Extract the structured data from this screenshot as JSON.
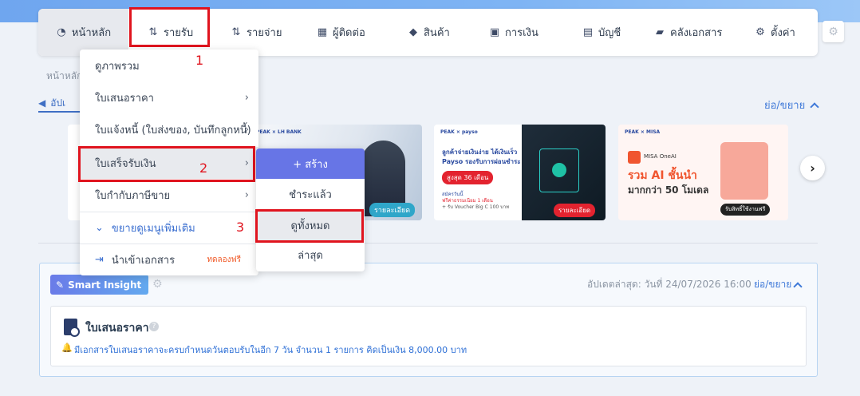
{
  "nav": {
    "items": [
      {
        "label": "หน้าหลัก",
        "icon": "dashboard-icon"
      },
      {
        "label": "รายรับ",
        "icon": "income-icon"
      },
      {
        "label": "รายจ่าย",
        "icon": "expense-icon"
      },
      {
        "label": "ผู้ติดต่อ",
        "icon": "contacts-icon"
      },
      {
        "label": "สินค้า",
        "icon": "box-icon"
      },
      {
        "label": "การเงิน",
        "icon": "money-icon"
      },
      {
        "label": "บัญชี",
        "icon": "ledger-icon"
      },
      {
        "label": "คลังเอกสาร",
        "icon": "folder-icon"
      },
      {
        "label": "ตั้งค่า",
        "icon": "gear-icon"
      }
    ]
  },
  "breadcrumb": "หน้าหลัก",
  "announcement_tab": "อัปเ",
  "collapse_label": "ย่อ/ขยาย",
  "dropdown": {
    "items": [
      {
        "label": "ดูภาพรวม"
      },
      {
        "label": "ใบเสนอราคา"
      },
      {
        "label": "ใบแจ้งหนี้ (ใบส่งของ, บันทึกลูกหนี้)"
      },
      {
        "label": "ใบเสร็จรับเงิน"
      },
      {
        "label": "ใบกำกับภาษีขาย"
      }
    ],
    "more_label": "ขยายดูเมนูเพิ่มเติม",
    "import_label": "นำเข้าเอกสาร",
    "import_badge": "ทดลองฟรี"
  },
  "submenu": {
    "create_label": "+ สร้าง",
    "items": [
      "ชำระแล้ว",
      "ดูทั้งหมด",
      "ล่าสุด"
    ]
  },
  "annotations": [
    "1",
    "2",
    "3"
  ],
  "banners": {
    "lh": {
      "logo": "PEAK × LH BANK",
      "button": "รายละเอียด"
    },
    "payso": {
      "logo": "PEAK × payso",
      "title_line1": "ลูกค้าจ่ายเงินง่าย ได้เงินเร็ว",
      "title_line2": "Payso รองรับการผ่อนชำระ",
      "pill": "สูงสุด 36 เดือน",
      "note_line1": "สมัครวันนี้",
      "note_line2": "ฟรีค่าธรรมเนียม 1 เดือน",
      "note_line3": "+ รับ Voucher Big C 100 บาท",
      "button": "รายละเอียด"
    },
    "misa": {
      "logo": "PEAK × MISA",
      "brand": "MISA OneAI",
      "headline1": "รวม AI ชั้นนำ",
      "headline2": "มากกว่า 50 โมเดล",
      "button": "รับสิทธิ์ใช้งานฟรี"
    }
  },
  "insight": {
    "badge": "Smart Insight",
    "updated": "อัปเดตล่าสุด: วันที่ 24/07/2026 16:00",
    "toggle": "ย่อ/ขยาย",
    "card_title": "ใบเสนอราคา",
    "alert": "มีเอกสารใบเสนอราคาจะครบกำหนดวันตอบรับในอีก 7 วัน จำนวน 1 รายการ คิดเป็นเงิน 8,000.00 บาท"
  },
  "colors": {
    "accent": "#6775e6",
    "link": "#3f79d8",
    "annotation": "#e0141e"
  }
}
